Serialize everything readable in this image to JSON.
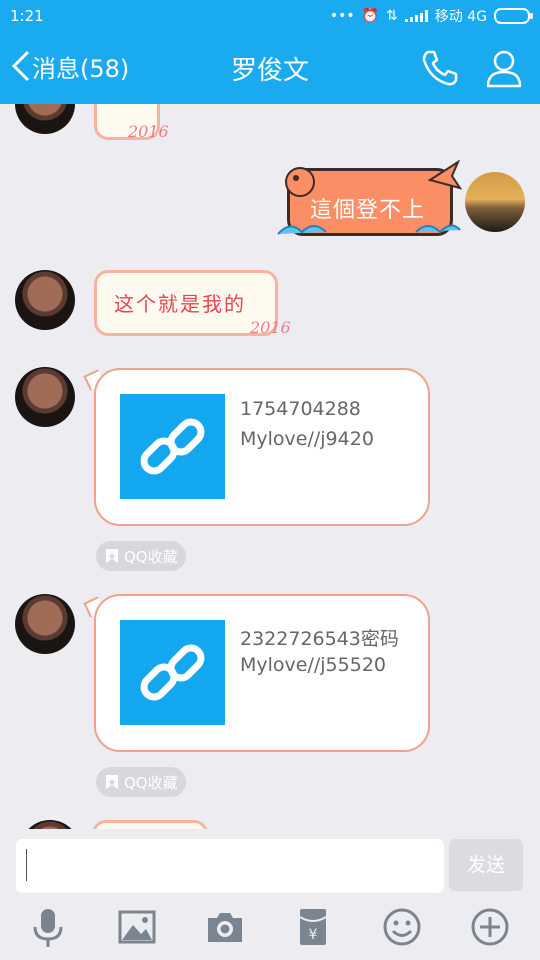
{
  "status": {
    "time": "1:21",
    "carrier": "移动 4G",
    "dots": "•••"
  },
  "header": {
    "back_label": "消息(58)",
    "title": "罗俊文"
  },
  "messages": [
    {
      "side": "left",
      "sticker_stamp": "2016"
    },
    {
      "side": "right",
      "text": "這個登不上"
    },
    {
      "side": "left",
      "sticker_text": "这个就是我的",
      "sticker_stamp": "2016"
    },
    {
      "side": "left",
      "card": {
        "line1": "1754704288",
        "line2": "Mylove//j9420"
      },
      "fav_label": "QQ收藏"
    },
    {
      "side": "left",
      "card": {
        "line1": "2322726543密码",
        "line2": "Mylove//j55520"
      },
      "fav_label": "QQ收藏"
    }
  ],
  "input": {
    "value": "",
    "send_label": "发送"
  },
  "toolbar": [
    "microphone-icon",
    "image-icon",
    "camera-icon",
    "red-packet-icon",
    "emoji-icon",
    "plus-icon"
  ],
  "colors": {
    "accent": "#1aaaf0",
    "bubble_border": "#f1a089",
    "link_thumb": "#13a7f0"
  }
}
